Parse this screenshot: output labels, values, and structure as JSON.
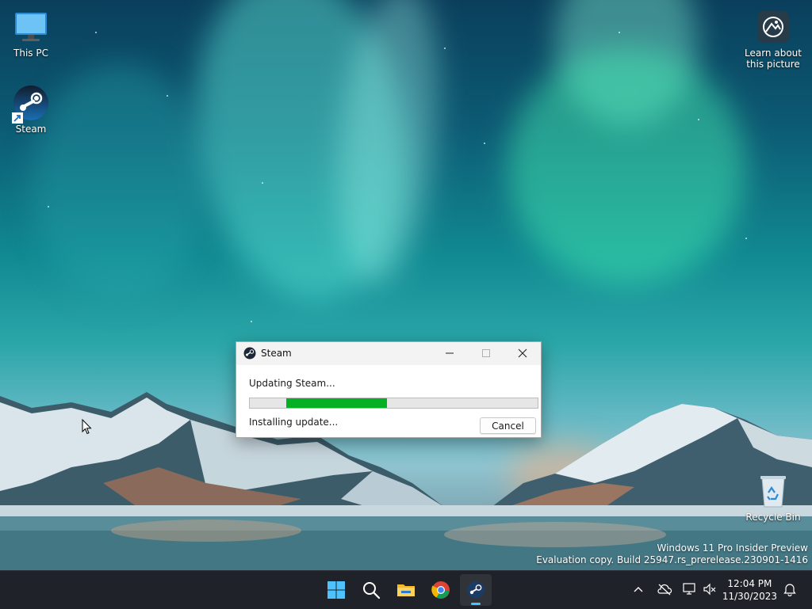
{
  "desktop": {
    "icons": [
      {
        "label": "This PC"
      },
      {
        "label": "Steam"
      },
      {
        "label": "Learn about this picture"
      },
      {
        "label": "Recycle Bin"
      }
    ],
    "watermark": {
      "line1": "Windows 11 Pro Insider Preview",
      "line2": "Evaluation copy. Build 25947.rs_prerelease.230901-1416"
    }
  },
  "dialog": {
    "title": "Steam",
    "heading": "Updating Steam...",
    "status": "Installing update...",
    "cancel_label": "Cancel",
    "progress": 0.35,
    "progress_color": "#06b025"
  },
  "taskbar": {
    "apps": [
      {
        "name": "start",
        "icon": "windows-logo-icon"
      },
      {
        "name": "search",
        "icon": "search-icon"
      },
      {
        "name": "file-explorer",
        "icon": "folder-icon"
      },
      {
        "name": "chrome",
        "icon": "chrome-icon"
      },
      {
        "name": "steam",
        "icon": "steam-icon",
        "active": true
      }
    ],
    "clock": {
      "time": "12:04 PM",
      "date": "11/30/2023"
    },
    "accent": "#4cc2ff"
  }
}
